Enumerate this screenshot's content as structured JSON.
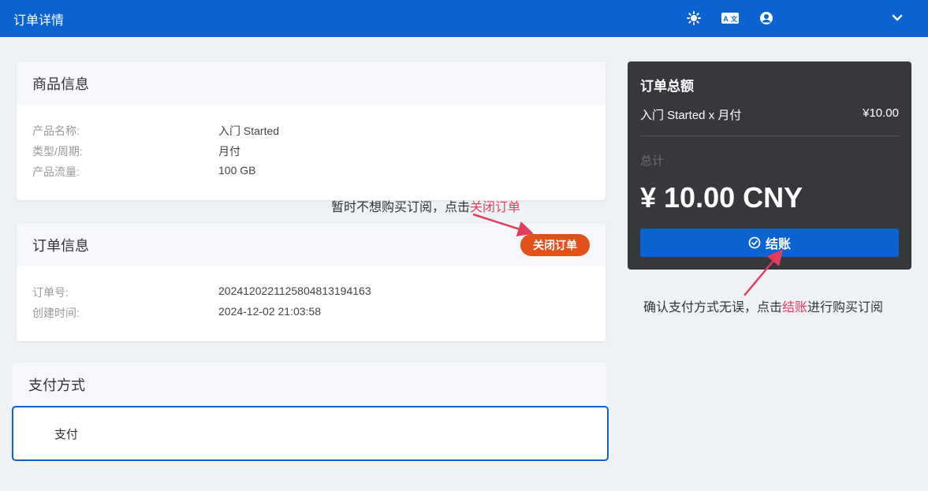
{
  "topbar": {
    "title": "订单详情",
    "icons": [
      "sun-icon",
      "translate-icon",
      "user-account-icon",
      "chevron-down-icon"
    ]
  },
  "product": {
    "heading": "商品信息",
    "rows": [
      {
        "label": "产品名称:",
        "value": "入门 Started"
      },
      {
        "label": "类型/周期:",
        "value": "月付"
      },
      {
        "label": "产品流量:",
        "value": "100 GB"
      }
    ]
  },
  "order": {
    "heading": "订单信息",
    "close_label": "关闭订单",
    "rows": [
      {
        "label": "订单号:",
        "value": "2024120221125804813194163"
      },
      {
        "label": "创建时间:",
        "value": "2024-12-02 21:03:58"
      }
    ]
  },
  "annotations": {
    "close_prefix": "暂时不想购买订阅，点击",
    "close_highlight": "关闭订单",
    "checkout_prefix": "确认支付方式无误，点击",
    "checkout_highlight": "结账",
    "checkout_suffix": "进行购买订阅"
  },
  "payment": {
    "heading": "支付方式",
    "option": "支付"
  },
  "summary": {
    "title": "订单总额",
    "item": "入门 Started x 月付",
    "item_price": "¥10.00",
    "total_label": "总计",
    "total_amount": "¥ 10.00 CNY",
    "checkout_label": "结账"
  },
  "colors": {
    "primary": "#0a63d0",
    "danger": "#e0521c",
    "highlight": "#e23c5c",
    "summary_bg": "#36383c"
  }
}
